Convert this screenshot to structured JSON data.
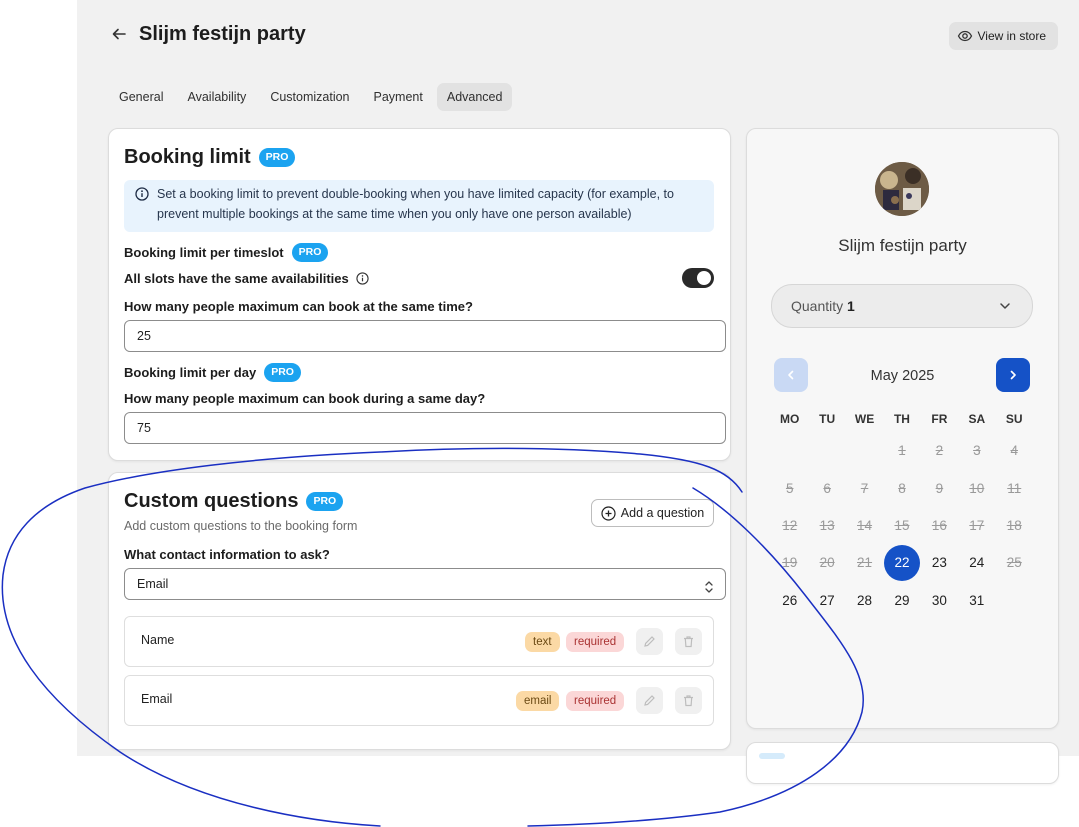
{
  "header": {
    "title": "Slijm festijn party",
    "view_store": "View in store"
  },
  "tabs": [
    "General",
    "Availability",
    "Customization",
    "Payment",
    "Advanced"
  ],
  "booking_limit": {
    "title": "Booking limit",
    "pro": "PRO",
    "info": "Set a booking limit to prevent double-booking when you have limited capacity (for example, to prevent multiple bookings at the same time when you only have one person available)",
    "per_timeslot_label": "Booking limit per timeslot",
    "same_avail_label": "All slots have the same availabilities",
    "same_avail_on": true,
    "max_same_time_label": "How many people maximum can book at the same time?",
    "max_same_time_value": "25",
    "per_day_label": "Booking limit per day",
    "max_same_day_label": "How many people maximum can book during a same day?",
    "max_same_day_value": "75"
  },
  "custom_questions": {
    "title": "Custom questions",
    "pro": "PRO",
    "subtitle": "Add custom questions to the booking form",
    "add_button": "Add a question",
    "contact_label": "What contact information to ask?",
    "contact_value": "Email",
    "questions": [
      {
        "name": "Name",
        "type": "text",
        "required": "required"
      },
      {
        "name": "Email",
        "type": "email",
        "required": "required"
      }
    ]
  },
  "preview": {
    "shop_name": "Slijm festijn party",
    "quantity_label": "Quantity",
    "quantity_value": "1",
    "month": "May 2025",
    "weekdays": [
      "MO",
      "TU",
      "WE",
      "TH",
      "FR",
      "SA",
      "SU"
    ],
    "selected_day": "22",
    "weeks": [
      [
        "",
        "",
        "",
        "1",
        "2",
        "3",
        "4"
      ],
      [
        "5",
        "6",
        "7",
        "8",
        "9",
        "10",
        "11"
      ],
      [
        "12",
        "13",
        "14",
        "15",
        "16",
        "17",
        "18"
      ],
      [
        "19",
        "20",
        "21",
        "22",
        "23",
        "24",
        "25"
      ],
      [
        "26",
        "27",
        "28",
        "29",
        "30",
        "31",
        ""
      ]
    ],
    "past_days": [
      "1",
      "2",
      "3",
      "4",
      "5",
      "6",
      "7",
      "8",
      "9",
      "10",
      "11",
      "12",
      "13",
      "14",
      "15",
      "16",
      "17",
      "18",
      "19",
      "20",
      "21",
      "25"
    ]
  },
  "colors": {
    "pro_badge": "#1ba3f0",
    "calendar_accent": "#1552c7",
    "annotation_stroke": "#1a2fc2"
  }
}
